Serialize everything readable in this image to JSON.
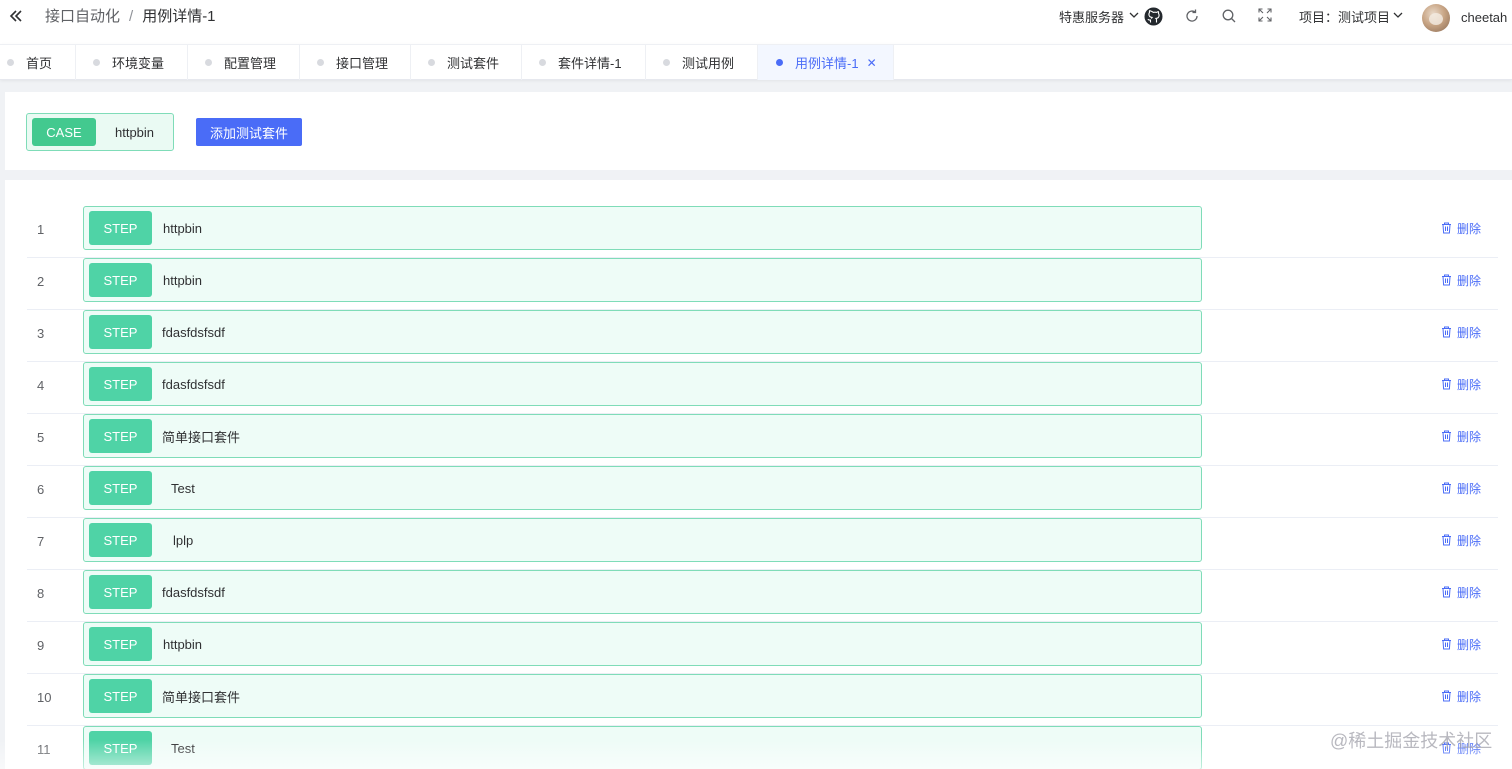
{
  "header": {
    "breadcrumb": {
      "parent": "接口自动化",
      "separator": "/",
      "current": "用例详情-1"
    },
    "server_select": {
      "value": "特惠服务器"
    },
    "project_select": {
      "label": "项目：",
      "value": "测试项目"
    },
    "username": "cheetah",
    "icons": [
      "double-chevron-left-icon",
      "github-icon",
      "refresh-icon",
      "search-icon",
      "fullscreen-icon",
      "chevron-down-icon"
    ]
  },
  "tabs": [
    {
      "label": "首页"
    },
    {
      "label": "环境变量"
    },
    {
      "label": "配置管理"
    },
    {
      "label": "接口管理"
    },
    {
      "label": "测试套件"
    },
    {
      "label": "套件详情-1"
    },
    {
      "label": "测试用例"
    },
    {
      "label": "用例详情-1",
      "active": true,
      "closable": true
    }
  ],
  "case": {
    "badge": "CASE",
    "name": "httpbin",
    "add_suite_label": "添加测试套件"
  },
  "steps": [
    {
      "index": "1",
      "badge": "STEP",
      "name": "httpbin",
      "delete_label": "删除"
    },
    {
      "index": "2",
      "badge": "STEP",
      "name": "httpbin",
      "delete_label": "删除"
    },
    {
      "index": "3",
      "badge": "STEP",
      "name": "fdasfdsfsdf",
      "delete_label": "删除"
    },
    {
      "index": "4",
      "badge": "STEP",
      "name": "fdasfdsfsdf",
      "delete_label": "删除"
    },
    {
      "index": "5",
      "badge": "STEP",
      "name": "简单接口套件",
      "delete_label": "删除"
    },
    {
      "index": "6",
      "badge": "STEP",
      "name": "Test",
      "delete_label": "删除"
    },
    {
      "index": "7",
      "badge": "STEP",
      "name": "lplp",
      "delete_label": "删除"
    },
    {
      "index": "8",
      "badge": "STEP",
      "name": "fdasfdsfsdf",
      "delete_label": "删除"
    },
    {
      "index": "9",
      "badge": "STEP",
      "name": "httpbin",
      "delete_label": "删除"
    },
    {
      "index": "10",
      "badge": "STEP",
      "name": "简单接口套件",
      "delete_label": "删除"
    },
    {
      "index": "11",
      "badge": "STEP",
      "name": "Test",
      "delete_label": "删除"
    }
  ],
  "watermark": "@稀土掘金技术社区",
  "colors": {
    "accent": "#4a6cf7",
    "case_green": "#43c98f",
    "step_green": "#4fd3a6",
    "step_border": "#7fdcb8",
    "step_bg": "#eefcf7"
  }
}
